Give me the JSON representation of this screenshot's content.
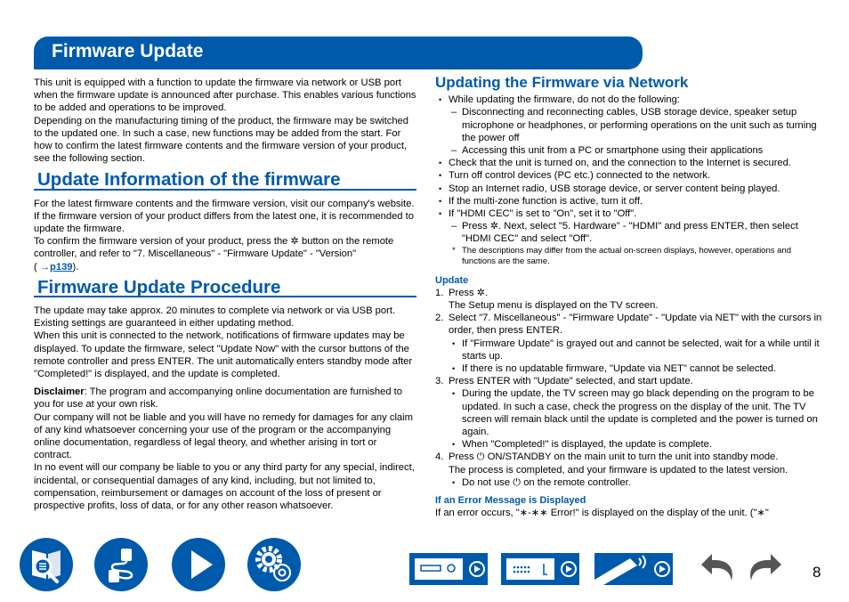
{
  "banner": {
    "title": "Firmware Update"
  },
  "intro": [
    "This unit is equipped with a function to update the firmware via network or USB port when the firmware update is announced after purchase. This enables various functions to be added and operations to be improved.",
    "Depending on the manufacturing timing of the product, the firmware may be switched to the updated one. In such a case, new functions may be added from the start. For how to confirm the latest firmware contents and the firmware version of your product, see the following section."
  ],
  "update_info": {
    "heading": "Update Information of the firmware",
    "p1": "For the latest firmware contents and the firmware version, visit our company's website. If the firmware version of your product differs from the latest one, it is recommended to update the firmware.",
    "p2_before": "To confirm the firmware version of your product, press the",
    "p2_after": "button on the remote controller, and refer to \"7. Miscellaneous\" - \"Firmware Update\" - \"Version\"",
    "ref_open": "(",
    "ref_arrow": "→",
    "ref_link": "p139",
    "ref_close": ")."
  },
  "procedure": {
    "heading": "Firmware Update Procedure",
    "p1": "The update may take approx. 20 minutes to complete via network or via USB port. Existing settings are guaranteed in either updating method.",
    "p2": "When this unit is connected to the network, notifications of firmware updates may be displayed. To update the firmware, select \"Update Now\" with the cursor buttons of the remote controller and press ENTER. The unit automatically enters standby mode after \"Completed!\" is displayed, and the update is completed.",
    "disclaimer_label": "Disclaimer",
    "disclaimer_text": ": The program and accompanying online documentation are furnished to you for use at your own risk.",
    "p3": "Our company will not be liable and you will have no remedy for damages for any claim of any kind whatsoever concerning your use of the program or the accompanying online documentation, regardless of legal theory, and whether arising in tort or contract.",
    "p4": "In no event will our company be liable to you or any third party for any special, indirect, incidental, or consequential damages of any kind, including, but not limited to, compensation, reimbursement or damages on account of the loss of present or prospective profits, loss of data, or for any other reason whatsoever."
  },
  "network": {
    "heading": "Updating the Firmware via Network",
    "bullet1": "While updating the firmware, do not do the following:",
    "dash1": "Disconnecting and reconnecting cables, USB storage device, speaker setup microphone or headphones, or performing operations on the unit such as turning the power off",
    "dash2": "Accessing this unit from a PC or smartphone using their applications",
    "bullet2": "Check that the unit is turned on, and the connection to the Internet is secured.",
    "bullet3": "Turn off control devices (PC etc.) connected to the network.",
    "bullet4": "Stop an Internet radio, USB storage device, or server content being played.",
    "bullet5": "If the multi-zone function is active, turn it off.",
    "bullet6": "If \"HDMI CEC\" is set to \"On\", set it to \"Off\".",
    "dash3_before": "Press",
    "dash3_after": ". Next, select \"5. Hardware\" - \"HDMI\" and press ENTER, then select \"HDMI CEC\" and select \"Off\".",
    "note": "The descriptions may differ from the actual on-screen displays, however, operations and functions are the same.",
    "update_heading": "Update",
    "steps": {
      "s1_num": "1.",
      "s1_before": "Press",
      "s1_after": ".",
      "s1_line2": "The Setup menu is displayed on the TV screen.",
      "s2_num": "2.",
      "s2": "Select \"7. Miscellaneous\" - \"Firmware Update\" - \"Update via NET\" with the cursors in order, then press ENTER.",
      "s2_b1": "If \"Firmware Update\" is grayed out and cannot be selected, wait for a while until it starts up.",
      "s2_b2": "If there is no updatable firmware, \"Update via NET\" cannot be selected.",
      "s3_num": "3.",
      "s3": "Press ENTER with \"Update\" selected, and start update.",
      "s3_b1": "During the update, the TV screen may go black depending on the program to be updated. In such a case, check the progress on the display of the unit. The TV screen will remain black until the update is completed and the power is turned on again.",
      "s3_b2": "When \"Completed!\" is displayed, the update is complete.",
      "s4_num": "4.",
      "s4_before": "Press",
      "s4_after": "ON/STANDBY on the main unit to turn the unit into standby mode.",
      "s4_line2": "The process is completed, and your firmware is updated to the latest version.",
      "s4_b1_before": "Do not use",
      "s4_b1_after": "on the remote controller."
    },
    "error_heading": "If an Error Message is Displayed",
    "error_text": "If an error occurs, \"∗-∗∗ Error!\" is displayed on the display of the unit. (\"∗\""
  },
  "nav": {
    "icons": [
      "contents-icon",
      "connections-icon",
      "playback-icon",
      "setup-icon"
    ],
    "device_buttons": [
      "front-panel-icon",
      "rear-panel-icon",
      "remote-controller-icon"
    ]
  },
  "page_number": "8",
  "colors": {
    "brand": "#005aab",
    "nav_gray": "#555555"
  }
}
